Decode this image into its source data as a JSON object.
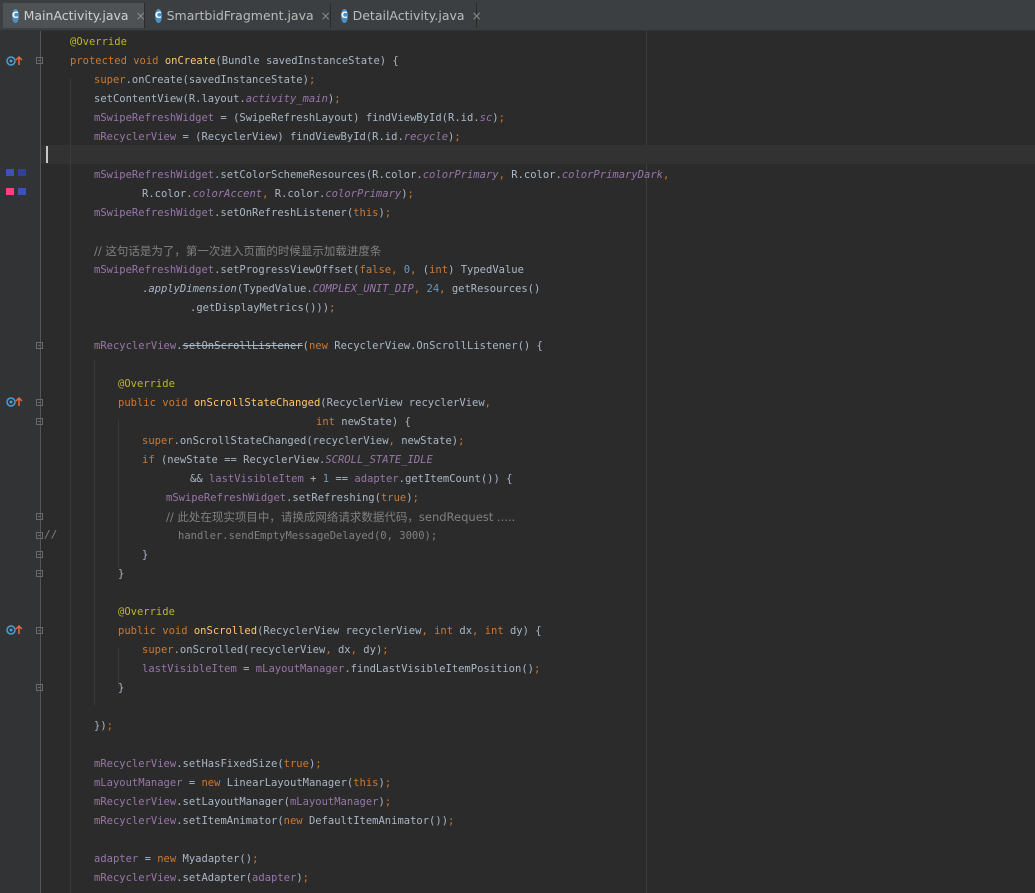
{
  "tabs": [
    {
      "label": "MainActivity.java",
      "icon": "C",
      "active": true
    },
    {
      "label": "SmartbidFragment.java",
      "icon": "C",
      "active": false
    },
    {
      "label": "DetailActivity.java",
      "icon": "C",
      "active": false
    }
  ],
  "gutter": {
    "comment_marker": "//",
    "swatches": {
      "colorPrimary": "#3f51b5",
      "colorPrimaryDark": "#303f9f",
      "colorAccent": "#ff4081"
    }
  },
  "code": {
    "chinese_comment_1": "// 这句话是为了，第一次进入页面的时候显示加载进度条",
    "chinese_comment_2": "// 此处在现实项目中，请换成网络请求数据代码，sendRequest .....",
    "commented_handler_line": "handler.sendEmptyMessageDelayed(0, 3000);"
  },
  "colors": {
    "background": "#2b2b2b",
    "keyword": "#cc7832",
    "annotation": "#bbb529",
    "field": "#9876aa",
    "method_decl": "#ffc66d",
    "number": "#6897bb",
    "comment": "#808080",
    "text": "#a9b7c6"
  }
}
